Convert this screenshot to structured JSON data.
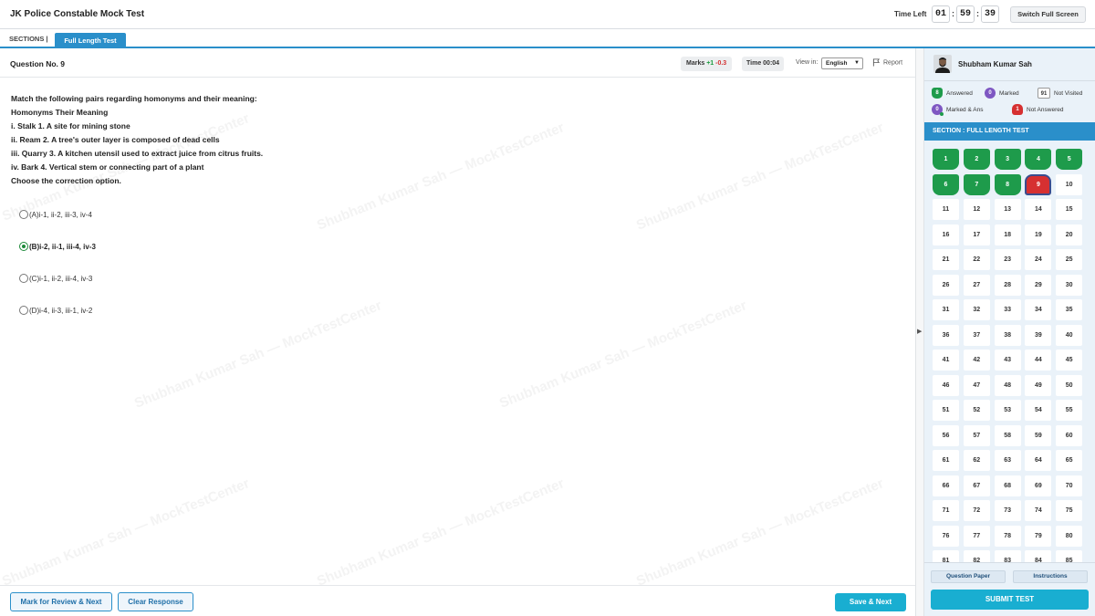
{
  "header": {
    "title": "JK Police Constable Mock Test",
    "time_left_label": "Time Left",
    "timer": {
      "hours": "01",
      "minutes": "59",
      "seconds": "39"
    },
    "fullscreen_label": "Switch Full Screen"
  },
  "sections": {
    "label": "SECTIONS |",
    "active_tab": "Full Length Test"
  },
  "question": {
    "number_label": "Question No. 9",
    "marks_label": "Marks",
    "marks_positive": "+1",
    "marks_negative": "-0.3",
    "time_label": "Time 00:04",
    "view_in_label": "View in:",
    "language": "English",
    "report_label": "Report",
    "lines": [
      "Match the following pairs regarding homonyms and their meaning:",
      "Homonyms Their Meaning",
      "i. Stalk 1. A site for mining stone",
      "ii. Ream 2. A tree's outer layer is composed of dead cells",
      "iii. Quarry 3. A kitchen utensil used to extract juice from citrus fruits.",
      "iv. Bark 4. Vertical stem or connecting part of a plant",
      "Choose the correction option."
    ],
    "options": [
      {
        "label": "(A)i-1, ii-2, iii-3, iv-4",
        "selected": false
      },
      {
        "label": "(B)i-2, ii-1, iii-4, iv-3",
        "selected": true
      },
      {
        "label": "(C)i-1, ii-2, iii-4, iv-3",
        "selected": false
      },
      {
        "label": "(D)i-4, ii-3, iii-1, iv-2",
        "selected": false
      }
    ]
  },
  "watermark_text": "Shubham Kumar Sah — MockTestCenter",
  "footer": {
    "mark_review_label": "Mark for Review & Next",
    "clear_label": "Clear Response",
    "save_next_label": "Save & Next"
  },
  "panel": {
    "user_name": "Shubham Kumar Sah",
    "legend": {
      "answered": {
        "count": "8",
        "label": "Answered"
      },
      "marked": {
        "count": "0",
        "label": "Marked"
      },
      "not_visited": {
        "count": "91",
        "label": "Not Visited"
      },
      "marked_ans": {
        "count": "0",
        "label": "Marked & Ans"
      },
      "not_answered": {
        "count": "1",
        "label": "Not Answered"
      }
    },
    "section_header": "SECTION : FULL LENGTH TEST",
    "question_paper_label": "Question Paper",
    "instructions_label": "Instructions",
    "submit_label": "SUBMIT TEST",
    "questions": [
      {
        "n": "1",
        "s": "answered"
      },
      {
        "n": "2",
        "s": "answered"
      },
      {
        "n": "3",
        "s": "answered"
      },
      {
        "n": "4",
        "s": "answered"
      },
      {
        "n": "5",
        "s": "answered"
      },
      {
        "n": "6",
        "s": "answered"
      },
      {
        "n": "7",
        "s": "answered"
      },
      {
        "n": "8",
        "s": "answered"
      },
      {
        "n": "9",
        "s": "notanswered"
      },
      {
        "n": "10",
        "s": "notvisited"
      },
      {
        "n": "11",
        "s": "notvisited"
      },
      {
        "n": "12",
        "s": "notvisited"
      },
      {
        "n": "13",
        "s": "notvisited"
      },
      {
        "n": "14",
        "s": "notvisited"
      },
      {
        "n": "15",
        "s": "notvisited"
      },
      {
        "n": "16",
        "s": "notvisited"
      },
      {
        "n": "17",
        "s": "notvisited"
      },
      {
        "n": "18",
        "s": "notvisited"
      },
      {
        "n": "19",
        "s": "notvisited"
      },
      {
        "n": "20",
        "s": "notvisited"
      },
      {
        "n": "21",
        "s": "notvisited"
      },
      {
        "n": "22",
        "s": "notvisited"
      },
      {
        "n": "23",
        "s": "notvisited"
      },
      {
        "n": "24",
        "s": "notvisited"
      },
      {
        "n": "25",
        "s": "notvisited"
      },
      {
        "n": "26",
        "s": "notvisited"
      },
      {
        "n": "27",
        "s": "notvisited"
      },
      {
        "n": "28",
        "s": "notvisited"
      },
      {
        "n": "29",
        "s": "notvisited"
      },
      {
        "n": "30",
        "s": "notvisited"
      },
      {
        "n": "31",
        "s": "notvisited"
      },
      {
        "n": "32",
        "s": "notvisited"
      },
      {
        "n": "33",
        "s": "notvisited"
      },
      {
        "n": "34",
        "s": "notvisited"
      },
      {
        "n": "35",
        "s": "notvisited"
      },
      {
        "n": "36",
        "s": "notvisited"
      },
      {
        "n": "37",
        "s": "notvisited"
      },
      {
        "n": "38",
        "s": "notvisited"
      },
      {
        "n": "39",
        "s": "notvisited"
      },
      {
        "n": "40",
        "s": "notvisited"
      },
      {
        "n": "41",
        "s": "notvisited"
      },
      {
        "n": "42",
        "s": "notvisited"
      },
      {
        "n": "43",
        "s": "notvisited"
      },
      {
        "n": "44",
        "s": "notvisited"
      },
      {
        "n": "45",
        "s": "notvisited"
      },
      {
        "n": "46",
        "s": "notvisited"
      },
      {
        "n": "47",
        "s": "notvisited"
      },
      {
        "n": "48",
        "s": "notvisited"
      },
      {
        "n": "49",
        "s": "notvisited"
      },
      {
        "n": "50",
        "s": "notvisited"
      },
      {
        "n": "51",
        "s": "notvisited"
      },
      {
        "n": "52",
        "s": "notvisited"
      },
      {
        "n": "53",
        "s": "notvisited"
      },
      {
        "n": "54",
        "s": "notvisited"
      },
      {
        "n": "55",
        "s": "notvisited"
      },
      {
        "n": "56",
        "s": "notvisited"
      },
      {
        "n": "57",
        "s": "notvisited"
      },
      {
        "n": "58",
        "s": "notvisited"
      },
      {
        "n": "59",
        "s": "notvisited"
      },
      {
        "n": "60",
        "s": "notvisited"
      },
      {
        "n": "61",
        "s": "notvisited"
      },
      {
        "n": "62",
        "s": "notvisited"
      },
      {
        "n": "63",
        "s": "notvisited"
      },
      {
        "n": "64",
        "s": "notvisited"
      },
      {
        "n": "65",
        "s": "notvisited"
      },
      {
        "n": "66",
        "s": "notvisited"
      },
      {
        "n": "67",
        "s": "notvisited"
      },
      {
        "n": "68",
        "s": "notvisited"
      },
      {
        "n": "69",
        "s": "notvisited"
      },
      {
        "n": "70",
        "s": "notvisited"
      },
      {
        "n": "71",
        "s": "notvisited"
      },
      {
        "n": "72",
        "s": "notvisited"
      },
      {
        "n": "73",
        "s": "notvisited"
      },
      {
        "n": "74",
        "s": "notvisited"
      },
      {
        "n": "75",
        "s": "notvisited"
      },
      {
        "n": "76",
        "s": "notvisited"
      },
      {
        "n": "77",
        "s": "notvisited"
      },
      {
        "n": "78",
        "s": "notvisited"
      },
      {
        "n": "79",
        "s": "notvisited"
      },
      {
        "n": "80",
        "s": "notvisited"
      },
      {
        "n": "81",
        "s": "notvisited"
      },
      {
        "n": "82",
        "s": "notvisited"
      },
      {
        "n": "83",
        "s": "notvisited"
      },
      {
        "n": "84",
        "s": "notvisited"
      },
      {
        "n": "85",
        "s": "notvisited"
      }
    ]
  }
}
